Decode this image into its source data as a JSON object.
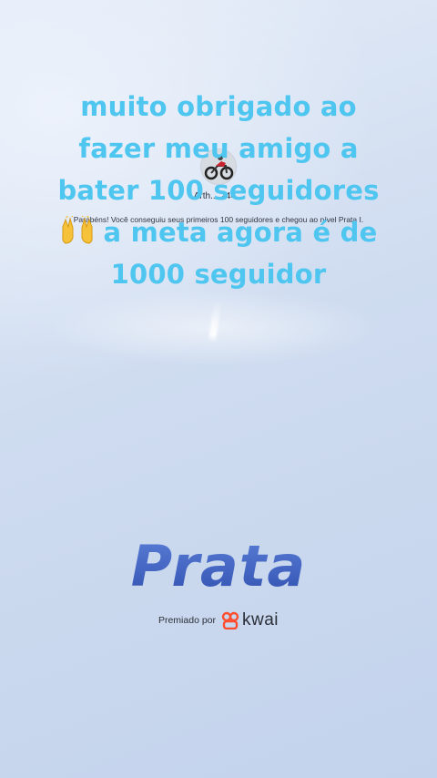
{
  "caption": {
    "lines": [
      "muito obrigado ao",
      "fazer meu amigo a",
      "bater 100 seguidores",
      "a meta agora é de",
      "1000 seguidor"
    ],
    "emoji": "raising-hands-icon"
  },
  "profile": {
    "username": "Arth... 244...",
    "message": "Parabéns! Você conseguiu seus primeiros 100 seguidores e chegou ao nível Prata I."
  },
  "level": {
    "title": "Prata"
  },
  "award": {
    "label": "Premiado por",
    "brand": "kwai"
  },
  "colors": {
    "caption": "#4ec6f0",
    "level": "#3f5fc0",
    "brand_logo": "#ff4d2d"
  }
}
